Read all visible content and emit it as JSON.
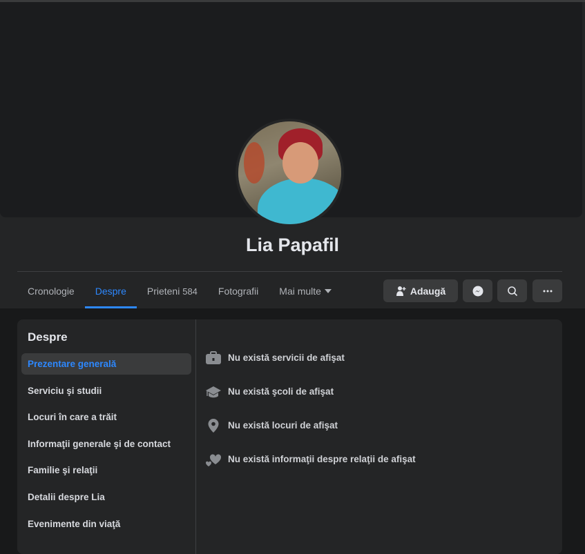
{
  "profile": {
    "name": "Lia Papafil"
  },
  "tabs": [
    {
      "label": "Cronologie"
    },
    {
      "label": "Despre"
    },
    {
      "label": "Prieteni",
      "count": "584"
    },
    {
      "label": "Fotografii"
    },
    {
      "label": "Mai multe"
    }
  ],
  "actions": {
    "add_friend": "Adaugă"
  },
  "about": {
    "title": "Despre",
    "nav": [
      "Prezentare generală",
      "Serviciu şi studii",
      "Locuri în care a trăit",
      "Informaţii generale şi de contact",
      "Familie şi relaţii",
      "Detalii despre Lia",
      "Evenimente din viaţă"
    ],
    "items": [
      "Nu există servicii de afişat",
      "Nu există şcoli de afişat",
      "Nu există locuri de afişat",
      "Nu există informaţii despre relaţii de afişat"
    ]
  },
  "colors": {
    "accent": "#2d88ff",
    "surface": "#242526",
    "background": "#18191a"
  }
}
